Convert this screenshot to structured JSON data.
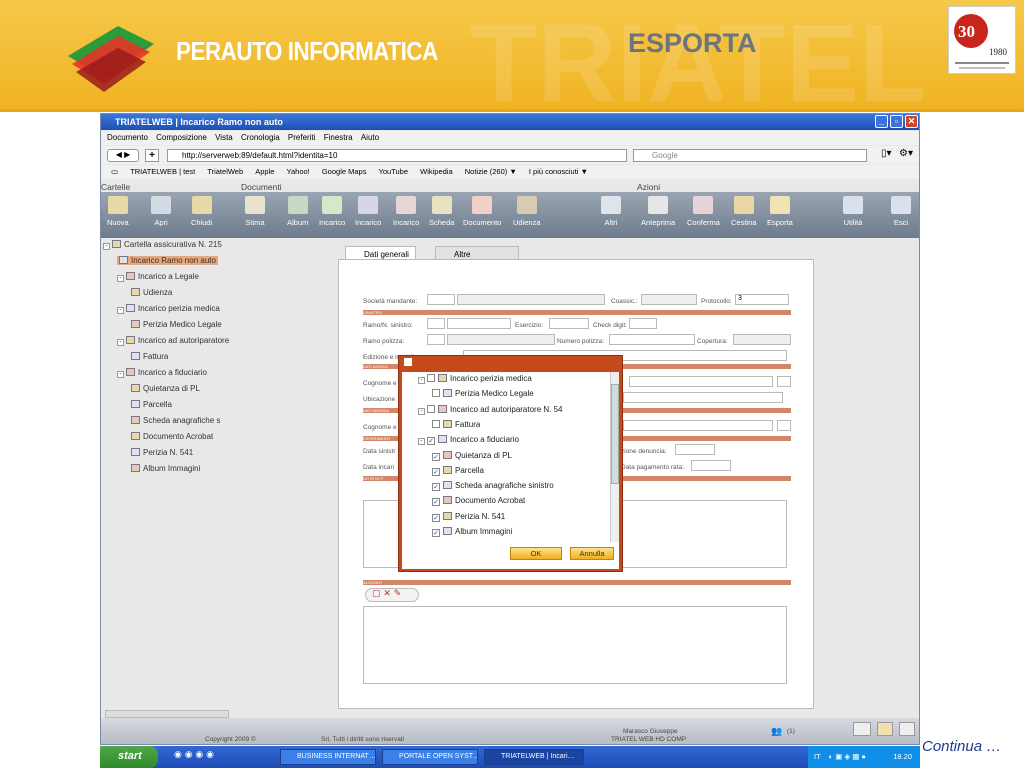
{
  "slide": {
    "brand": "PERAUTO INFORMATICA",
    "title": "ESPORTA",
    "continue": "Continua …",
    "seal_text": "30 anni 1980 il primo software"
  },
  "browser": {
    "window_title": "TRIATELWEB | Incarico Ramo non auto",
    "menu": [
      "Documento",
      "Composizione",
      "Vista",
      "Cronologia",
      "Preferiti",
      "Finestra",
      "Aiuto"
    ],
    "url": "http://serverweb:89/default.html?identita=10",
    "search_placeholder": "Google",
    "bookmarks": [
      "TRIATELWEB | test",
      "TriatelWeb",
      "Apple",
      "Yahoo!",
      "Google Maps",
      "YouTube",
      "Wikipedia",
      "Notizie (260) ▼",
      "I più conosciuti ▼"
    ]
  },
  "toolbar": {
    "sections": {
      "cartelle": "Cartelle",
      "documenti": "Documenti",
      "azioni": "Azioni"
    },
    "cartelle": [
      "Nuova",
      "Apri",
      "Chiudi"
    ],
    "documenti": [
      "Stima",
      "Album",
      "Incarico",
      "Incarico",
      "Incarico",
      "Scheda",
      "Documento",
      "Udienza"
    ],
    "azioni": [
      "Altri",
      "Anteprima",
      "Conferma",
      "Cestina",
      "Esporta"
    ],
    "extra": [
      "Utilità",
      "Esci"
    ]
  },
  "tree": [
    {
      "label": "Cartella assicurativa N. 215",
      "level": 0,
      "exp": "-"
    },
    {
      "label": "Incarico Ramo non auto",
      "level": 1,
      "sel": true
    },
    {
      "label": "Incarico a Legale",
      "level": 1,
      "exp": "-"
    },
    {
      "label": "Udienza",
      "level": 2
    },
    {
      "label": "Incarico perizia medica",
      "level": 1,
      "exp": "-"
    },
    {
      "label": "Perizia Medico Legale",
      "level": 2
    },
    {
      "label": "Incarico ad autoriparatore",
      "level": 1,
      "exp": "-"
    },
    {
      "label": "Fattura",
      "level": 2
    },
    {
      "label": "Incarico a fiduciario",
      "level": 1,
      "exp": "-"
    },
    {
      "label": "Quietanza di PL",
      "level": 2
    },
    {
      "label": "Parcella",
      "level": 2
    },
    {
      "label": "Scheda anagrafiche s",
      "level": 2
    },
    {
      "label": "Documento Acrobat",
      "level": 2
    },
    {
      "label": "Perizia N. 541",
      "level": 2
    },
    {
      "label": "Album Immagini",
      "level": 2
    }
  ],
  "tabs": {
    "general": "Dati generali",
    "other": "Altre informazioni"
  },
  "form": {
    "societa": "Società mandante:",
    "coassic": "Coassic.:",
    "protocollo": "Protocollo:",
    "protocollo_val": "3",
    "sinistro_band": "SINISTRO",
    "ramo_sinistro": "Ramo/N. sinistro:",
    "esercizio": "Esercizio:",
    "check": "Check digit:",
    "ramo_polizza": "Ramo polizza:",
    "numero_polizza": "Numero polizza:",
    "copertura": "Copertura:",
    "edizione": "Edizione e modello:",
    "dati_band": "DATI ASSICU",
    "cognome": "Cognome e",
    "ubicazione": "Ubicazione",
    "dati2_band": "DATI ADENZA",
    "cognome2": "Cognome e",
    "esperimenti_band": "ESPERIMENTI",
    "data_sinistro": "Data sinistr",
    "data_incarico": "Data incari",
    "note_band": "NOTE DI P",
    "denuncia": "zione denuncia:",
    "pagamento": "Data pagamento rata:",
    "allegati_band": "ALLEGATI"
  },
  "dialog": {
    "items": [
      {
        "label": "Incarico perizia medica",
        "level": 0,
        "checked": false,
        "exp": "-"
      },
      {
        "label": "Perizia Medico Legale",
        "level": 1,
        "checked": false
      },
      {
        "label": "Incarico ad autoriparatore N. 54",
        "level": 0,
        "checked": false,
        "exp": "-"
      },
      {
        "label": "Fattura",
        "level": 1,
        "checked": false
      },
      {
        "label": "Incarico a fiduciario",
        "level": 0,
        "checked": true,
        "exp": "-"
      },
      {
        "label": "Quietanza di PL",
        "level": 1,
        "checked": true
      },
      {
        "label": "Parcella",
        "level": 1,
        "checked": true
      },
      {
        "label": "Scheda anagrafiche sinistro",
        "level": 1,
        "checked": true
      },
      {
        "label": "Documento Acrobat",
        "level": 1,
        "checked": true
      },
      {
        "label": "Perizia N. 541",
        "level": 1,
        "checked": true
      },
      {
        "label": "Album Immagini",
        "level": 1,
        "checked": true
      }
    ],
    "ok": "OK",
    "cancel": "Annulla"
  },
  "status": {
    "copyright": "Copyright 2009 ©",
    "company": "Srl. Tutti i diritti sono riservati",
    "user": "Marasco Giuseppe",
    "product": "TRIATEL WEB HD COMP",
    "count": "(1)"
  },
  "taskbar": {
    "start": "start",
    "tasks": [
      "BUSINESS INTERNAT…",
      "PORTALE OPEN SYST…",
      "TRIATELWEB | Incari…"
    ],
    "lang": "IT",
    "time": "18.20"
  },
  "colors": {
    "banner": "#f2b930",
    "accent": "#c44a1c",
    "band": "#d3866a",
    "titlebar": "#2a60c8"
  }
}
